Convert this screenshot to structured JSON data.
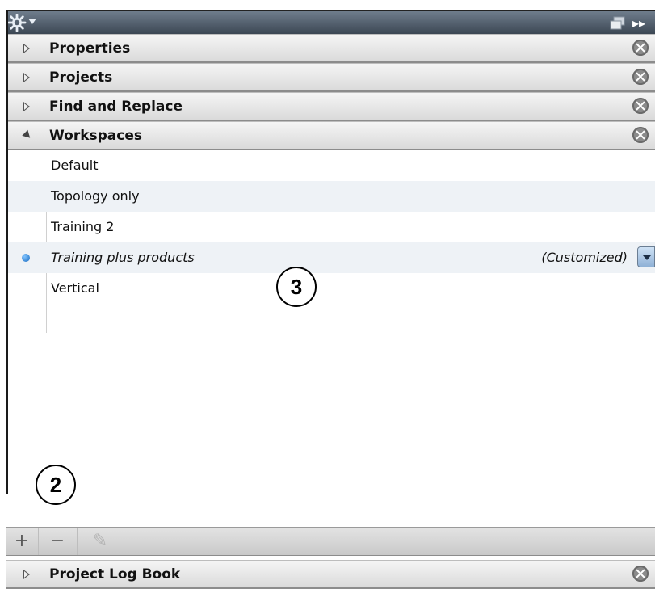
{
  "topbar": {
    "gear_icon": "gear-icon",
    "menu_caret": "chevron-down-icon",
    "float_icon": "float-panel-icon",
    "collapse_icon": "double-chevron-right-icon",
    "collapse_glyph": "▸▸"
  },
  "sections": [
    {
      "label": "Properties",
      "state": "collapsed"
    },
    {
      "label": "Projects",
      "state": "collapsed"
    },
    {
      "label": "Find and Replace",
      "state": "collapsed"
    },
    {
      "label": "Workspaces",
      "state": "expanded"
    }
  ],
  "workspaces": {
    "items": [
      {
        "label": "Default",
        "active": false
      },
      {
        "label": "Topology only",
        "active": false
      },
      {
        "label": "Training 2",
        "active": false
      },
      {
        "label": "Training plus products",
        "active": true,
        "status": "(Customized)"
      },
      {
        "label": "Vertical",
        "active": false
      }
    ]
  },
  "toolbar": {
    "add_label": "+",
    "remove_label": "−",
    "edit_label": "✎"
  },
  "bottom_section": {
    "label": "Project Log Book",
    "state": "collapsed"
  },
  "callouts": {
    "callout_2": "2",
    "callout_3": "3"
  },
  "colors": {
    "topbar": "#4a5663",
    "active_dot": "#1a6cc0",
    "selected_row": "#eef2f6"
  }
}
